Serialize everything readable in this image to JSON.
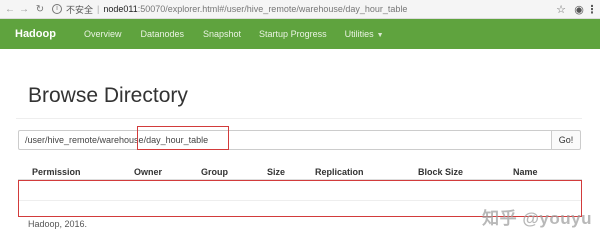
{
  "browser": {
    "security_text": "不安全",
    "url_host": "node011",
    "url_path": ":50070/explorer.html#/user/hive_remote/warehouse/day_hour_table",
    "icons": [
      "back-icon",
      "forward-icon",
      "reload-icon",
      "info-icon",
      "star-icon",
      "account-icon",
      "menu-icon"
    ]
  },
  "navbar": {
    "brand": "Hadoop",
    "items": [
      {
        "label": "Overview"
      },
      {
        "label": "Datanodes"
      },
      {
        "label": "Snapshot"
      },
      {
        "label": "Startup Progress"
      },
      {
        "label": "Utilities"
      }
    ],
    "color": "#5fa33e"
  },
  "page": {
    "title": "Browse Directory",
    "path_value": "/user/hive_remote/warehouse/day_hour_table",
    "go_label": "Go!"
  },
  "table": {
    "headers": [
      "Permission",
      "Owner",
      "Group",
      "Size",
      "Replication",
      "Block Size",
      "Name"
    ],
    "rows": []
  },
  "footer": {
    "text": "Hadoop, 2016."
  },
  "watermark": {
    "text": "知乎 @youyu"
  },
  "annotations": {
    "highlight_color": "#d23b3b"
  }
}
